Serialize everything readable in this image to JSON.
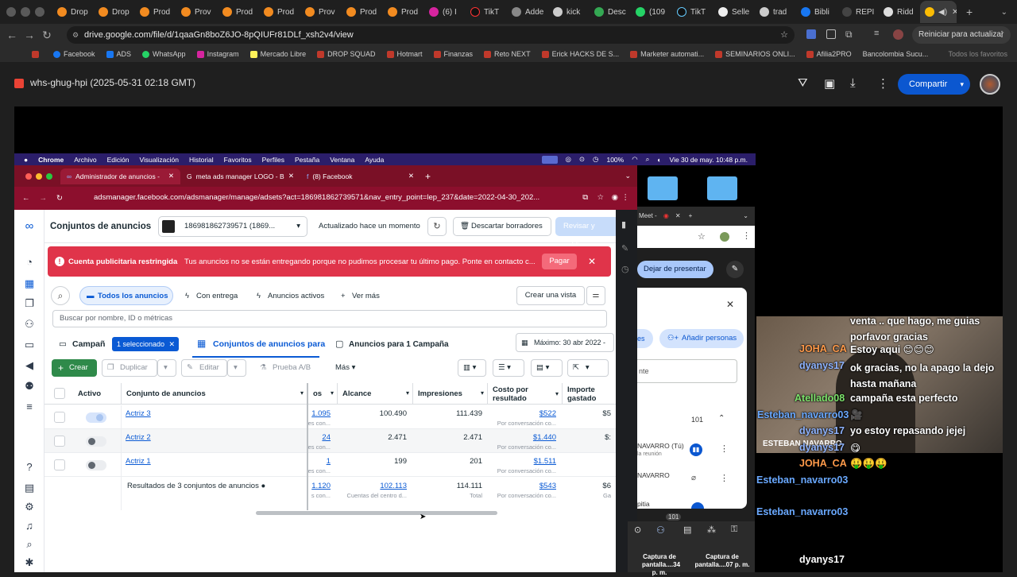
{
  "outer_tabs": [
    "Drop",
    "Drop",
    "Prod",
    "Prov",
    "Prod",
    "Prod",
    "Prov",
    "Prod",
    "Prod",
    "(6) I",
    "TikT",
    "Adde",
    "kick",
    "Desc",
    "(109",
    "TikT",
    "Selle",
    "trad",
    "Bibli",
    "REPI",
    "Ridd"
  ],
  "address": {
    "url": "drive.google.com/file/d/1qaaGn8boZ6JO-8pQIUFr81DLf_xsh2v4/view",
    "restart_label": "Reiniciar para actualizar"
  },
  "bookmarks": [
    "Facebook",
    "ADS",
    "WhatsApp",
    "Instagram",
    "Mercado Libre",
    "DROP SQUAD",
    "Hotmart",
    "Finanzas",
    "Reto NEXT",
    "Erick HACKS DE S...",
    "Marketer automati...",
    "SEMINARIOS ONLI...",
    "Afilia2PRO",
    "Bancolombia Sucu..."
  ],
  "bookmarks_all": "Todos los favoritos",
  "drive": {
    "title": "whs-ghug-hpi (2025-05-31 02:18 GMT)",
    "share_label": "Compartir"
  },
  "mac": {
    "apple": "",
    "app": "Chrome",
    "menu": [
      "Archivo",
      "Edición",
      "Visualización",
      "Historial",
      "Favoritos",
      "Perfiles",
      "Pestaña",
      "Ventana",
      "Ayuda"
    ],
    "battery": "100%",
    "datetime": "Vie 30 de may.  10:48 p.m."
  },
  "inner_tabs": [
    "Administrador de anuncios -",
    "meta ads manager LOGO - B",
    "(8) Facebook"
  ],
  "inner_url": "adsmanager.facebook.com/adsmanager/manage/adsets?act=186981862739571&nav_entry_point=lep_237&date=2022-04-30_202...",
  "header": {
    "title": "Conjuntos de anuncios",
    "account": "186981862739571 (1869...",
    "updated": "Actualizado hace un momento",
    "discard": "Descartar borradores",
    "review": "Revisar y publicar"
  },
  "alert": {
    "title": "Cuenta publicitaria restringida",
    "message": "Tus anuncios no se están entregando porque no pudimos procesar tu último pago. Ponte en contacto c...",
    "pay": "Pagar"
  },
  "filters": {
    "all_ads": "Todos los anuncios",
    "delivery": "Con entrega",
    "active": "Anuncios activos",
    "more": "Ver más",
    "create_view": "Crear una vista"
  },
  "search_placeholder": "Buscar por nombre, ID o métricas",
  "levels": {
    "campaign": "Campañ",
    "selected": "1 seleccionado",
    "adsets": "Conjuntos de anuncios para",
    "ads": "Anuncios para 1 Campaña",
    "date": "Máximo: 30 abr 2022 -"
  },
  "toolbar": {
    "create": "Crear",
    "duplicate": "Duplicar",
    "edit": "Editar",
    "ab": "Prueba A/B",
    "more": "Más"
  },
  "table": {
    "headers": {
      "active": "Activo",
      "name": "Conjunto de anuncios",
      "results_trunc": "os",
      "reach": "Alcance",
      "impressions": "Impresiones",
      "cpr": "Costo por resultado",
      "spent": "Importe gastado"
    },
    "rows": [
      {
        "name": "Actriz 3",
        "results": "1.095",
        "results_sub": "es con...",
        "reach": "100.490",
        "impressions": "111.439",
        "cpr": "$522",
        "cpr_sub": "Por conversación co...",
        "spent": "$5"
      },
      {
        "name": "Actriz 2",
        "results": "24",
        "results_sub": "es con...",
        "reach": "2.471",
        "impressions": "2.471",
        "cpr": "$1.440",
        "cpr_sub": "Por conversación co...",
        "spent": "$:"
      },
      {
        "name": "Actriz 1",
        "results": "1",
        "results_sub": "es con...",
        "reach": "199",
        "impressions": "201",
        "cpr": "$1.511",
        "cpr_sub": "Por conversación co...",
        "spent": ""
      }
    ],
    "totals": {
      "label": "Resultados de 3 conjuntos de anuncios",
      "results": "1.120",
      "results_sub": "s con...",
      "reach": "102.113",
      "reach_sub": "Cuentas del centro d...",
      "impressions": "114.111",
      "impressions_sub": "Total",
      "cpr": "$543",
      "cpr_sub": "Por conversación co...",
      "spent": "$6",
      "spent_sub": "Ga"
    }
  },
  "meet": {
    "tab": "Meet - ",
    "present": "Dejar de presentar",
    "add_people": "Añadir personas",
    "people_count": "101",
    "participant_1": "NAVARRO (Tú)",
    "participant_1_sub": "la reunión",
    "participant_2": "NAVARRO",
    "participant_3": "pitia",
    "badge": "101",
    "cap1": "Captura de",
    "cap1b": "pantalla....34 p. m.",
    "cap2": "Captura de",
    "cap2b": "pantalla....07 p. m."
  },
  "webcam_name": "ESTEBAN NAVARRO",
  "chat": [
    {
      "user": "",
      "msg": "venta .. que hago, me guias porfavor gracias"
    },
    {
      "user": "JOHA_CA",
      "msg": "Estoy aqui 😊😊😊"
    },
    {
      "user": "dyanys17",
      "msg": "ok gracias, no la apago la dejo hasta mañana"
    },
    {
      "user": "Atellado08",
      "msg": "campaña esta perfecto"
    },
    {
      "user": "Esteban_navarro03",
      "msg": "🎥"
    },
    {
      "user": "dyanys17",
      "msg": "yo estoy repasando jejej"
    },
    {
      "user": "dyanys17",
      "msg": "😋"
    },
    {
      "user": "JOHA_CA",
      "msg": "🤑🤑🤑"
    },
    {
      "user": "Esteban_navarro03",
      "msg": ""
    },
    {
      "user": "Esteban_navarro03",
      "msg": ""
    },
    {
      "user": "dyanys17",
      "msg": ""
    }
  ],
  "colors": {
    "facebook_blue": "#0a5ad4",
    "alert_red": "#e0344a",
    "drive_share": "#0b57d0",
    "create_green": "#2f8a4a"
  }
}
